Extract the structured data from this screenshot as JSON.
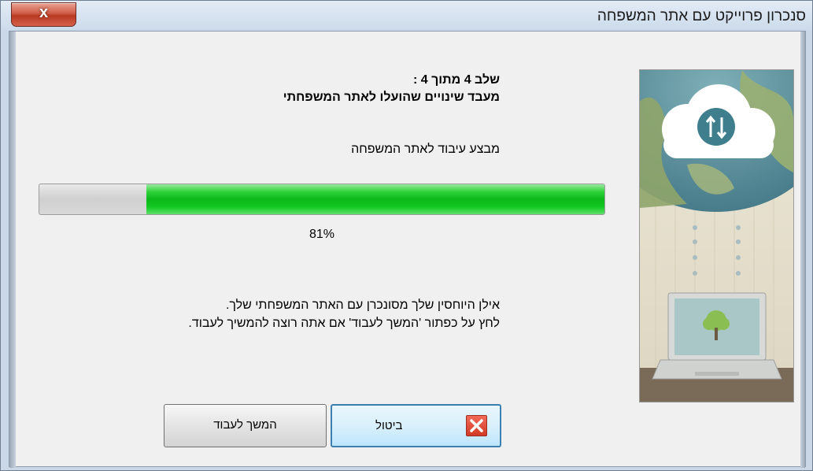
{
  "window": {
    "title": "סנכרון פרוייקט עם אתר המשפחה",
    "close_label": "x"
  },
  "step": {
    "title": "שלב 4 מתוך 4 :",
    "subtitle": "מעבד שינויים שהועלו לאתר המשפחתי"
  },
  "status": "מבצע עיבוד לאתר המשפחה",
  "progress": {
    "value": 0.81,
    "label": "81%"
  },
  "message": {
    "line1": "אילן היוחסין שלך מסונכרן עם האתר המשפחתי שלך.",
    "line2": "לחץ על כפתור 'המשך לעבוד' אם אתה רוצה להמשיך לעבוד."
  },
  "buttons": {
    "cancel_label": "ביטול",
    "continue_label": "המשך לעבוד"
  },
  "colors": {
    "progress_fill": "#0cb81a",
    "close_button": "#cf5b45",
    "cancel_icon": "#d23a24"
  }
}
